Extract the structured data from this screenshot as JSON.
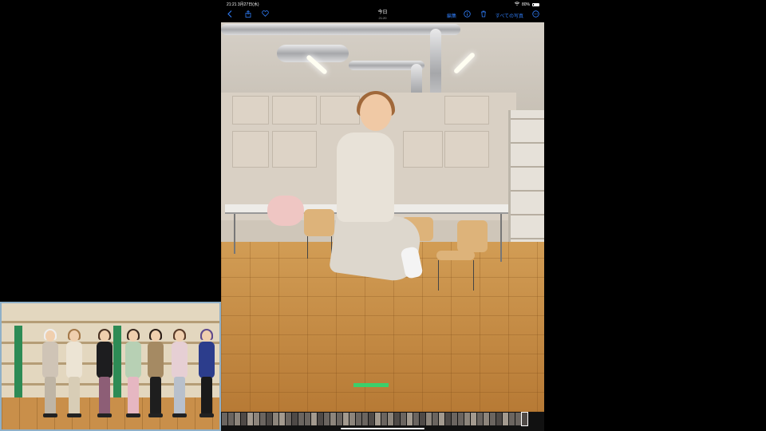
{
  "status_bar": {
    "time": "21:21",
    "date": "3月27日(水)",
    "battery": "80%"
  },
  "nav": {
    "title": "今日",
    "subtitle": "21:20",
    "edit_label": "編集",
    "all_photos_label": "すべての写真",
    "accent_color": "#2f7cf6"
  },
  "icons": {
    "back": "chevron-left-icon",
    "share": "share-icon",
    "favorite": "heart-icon",
    "info": "info-icon",
    "delete": "trash-icon",
    "more": "ellipsis-icon"
  },
  "thumbnail_count": 48
}
